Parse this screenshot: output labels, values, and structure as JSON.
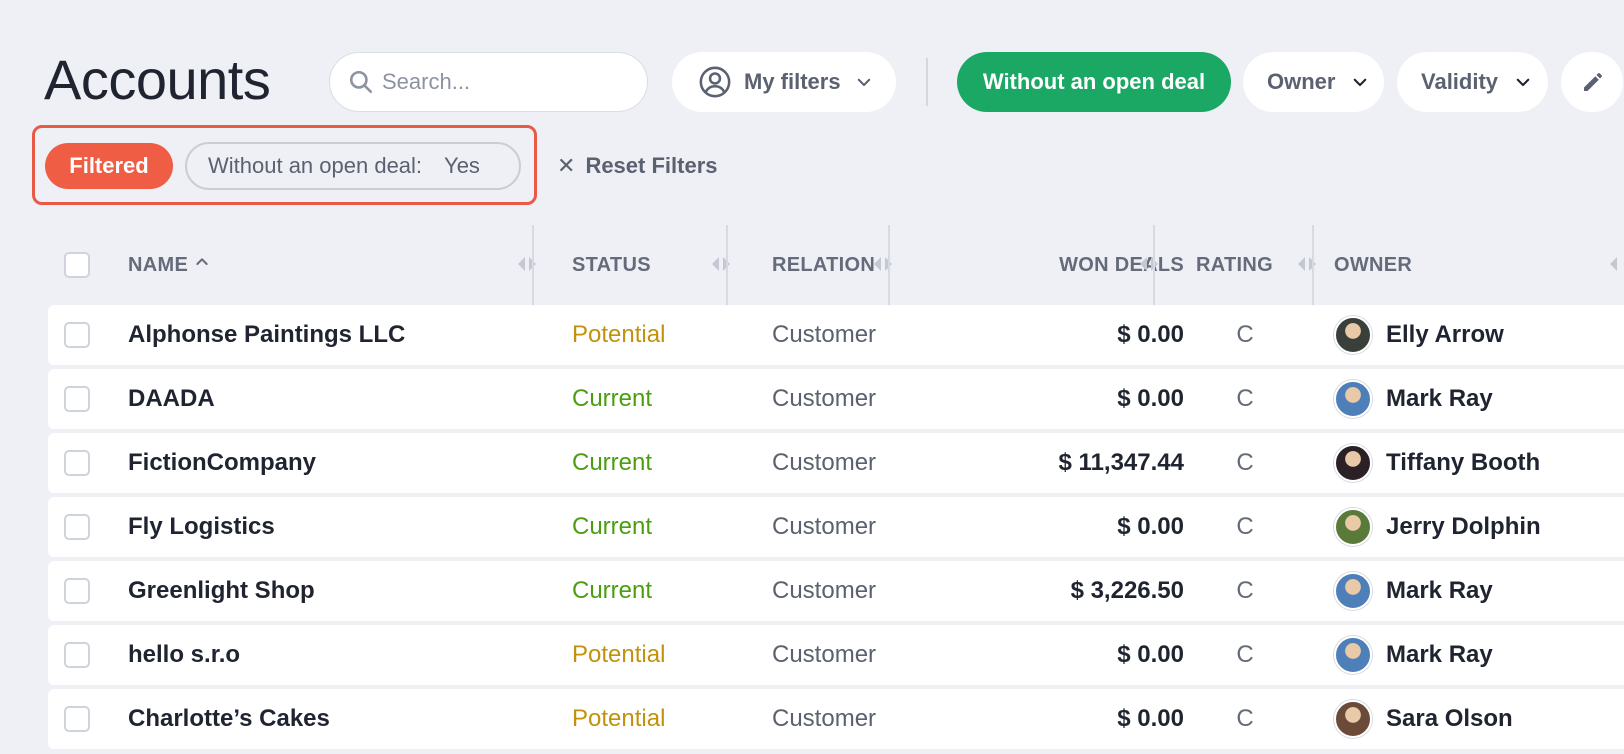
{
  "header": {
    "title": "Accounts",
    "search_placeholder": "Search...",
    "my_filters_label": "My filters",
    "quick_filter_label": "Without an open deal",
    "owner_label": "Owner",
    "validity_label": "Validity"
  },
  "filter_bar": {
    "badge": "Filtered",
    "chip_label": "Without an open deal:",
    "chip_value": "Yes",
    "reset_label": "Reset Filters"
  },
  "colors": {
    "quick_filter": "#1aa864",
    "filtered_badge": "#ef5d44",
    "highlight": "#e85a46",
    "potential": "#c1930b",
    "current": "#4b9f0f"
  },
  "table": {
    "columns": [
      "NAME",
      "STATUS",
      "RELATION",
      "WON DEALS",
      "RATING",
      "OWNER"
    ],
    "sort_column": "NAME",
    "rows": [
      {
        "name": "Alphonse Paintings LLC",
        "status": "Potential",
        "relation": "Customer",
        "won": "$ 0.00",
        "rating": "C",
        "owner": "Elly Arrow",
        "avatar": "#3a3f3a"
      },
      {
        "name": "DAADA",
        "status": "Current",
        "relation": "Customer",
        "won": "$ 0.00",
        "rating": "C",
        "owner": "Mark Ray",
        "avatar": "#4f7fb8"
      },
      {
        "name": "FictionCompany",
        "status": "Current",
        "relation": "Customer",
        "won": "$ 11,347.44",
        "rating": "C",
        "owner": "Tiffany Booth",
        "avatar": "#2a2026"
      },
      {
        "name": "Fly Logistics",
        "status": "Current",
        "relation": "Customer",
        "won": "$ 0.00",
        "rating": "C",
        "owner": "Jerry Dolphin",
        "avatar": "#5a7a3a"
      },
      {
        "name": "Greenlight Shop",
        "status": "Current",
        "relation": "Customer",
        "won": "$ 3,226.50",
        "rating": "C",
        "owner": "Mark Ray",
        "avatar": "#4f7fb8"
      },
      {
        "name": "hello s.r.o",
        "status": "Potential",
        "relation": "Customer",
        "won": "$ 0.00",
        "rating": "C",
        "owner": "Mark Ray",
        "avatar": "#4f7fb8"
      },
      {
        "name": "Charlotte’s Cakes",
        "status": "Potential",
        "relation": "Customer",
        "won": "$ 0.00",
        "rating": "C",
        "owner": "Sara Olson",
        "avatar": "#6b4a3a"
      }
    ]
  }
}
